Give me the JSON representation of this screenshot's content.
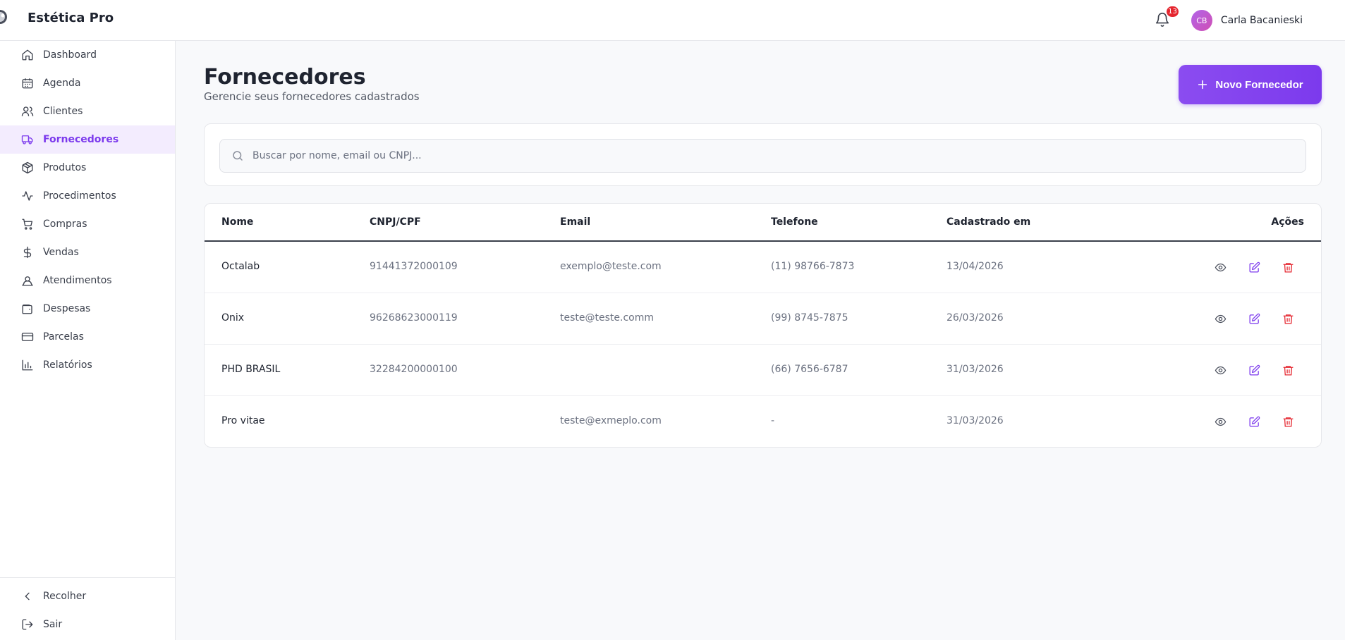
{
  "app": {
    "name": "Estética Pro"
  },
  "header": {
    "notifications_count": "13",
    "user_initials": "CB",
    "user_name": "Carla Bacanieski"
  },
  "sidebar": {
    "items": [
      {
        "label": "Dashboard",
        "icon": "home-icon"
      },
      {
        "label": "Agenda",
        "icon": "calendar-icon"
      },
      {
        "label": "Clientes",
        "icon": "users-icon"
      },
      {
        "label": "Fornecedores",
        "icon": "truck-icon",
        "active": true
      },
      {
        "label": "Produtos",
        "icon": "package-icon"
      },
      {
        "label": "Procedimentos",
        "icon": "activity-icon"
      },
      {
        "label": "Compras",
        "icon": "cart-icon"
      },
      {
        "label": "Vendas",
        "icon": "dollar-icon"
      },
      {
        "label": "Atendimentos",
        "icon": "user-pin-icon"
      },
      {
        "label": "Despesas",
        "icon": "wallet-icon"
      },
      {
        "label": "Parcelas",
        "icon": "credit-card-icon"
      },
      {
        "label": "Relatórios",
        "icon": "bar-chart-icon"
      }
    ],
    "collapse_label": "Recolher",
    "logout_label": "Sair"
  },
  "page": {
    "title": "Fornecedores",
    "subtitle": "Gerencie seus fornecedores cadastrados",
    "new_button_label": "Novo Fornecedor"
  },
  "search": {
    "placeholder": "Buscar por nome, email ou CNPJ...",
    "value": ""
  },
  "table": {
    "columns": [
      "Nome",
      "CNPJ/CPF",
      "Email",
      "Telefone",
      "Cadastrado em",
      "Ações"
    ],
    "rows": [
      {
        "nome": "Octalab",
        "cnpj": "91441372000109",
        "email": "exemplo@teste.com",
        "telefone": "(11) 98766-7873",
        "cadastrado": "13/04/2026"
      },
      {
        "nome": "Onix",
        "cnpj": "96268623000119",
        "email": "teste@teste.comm",
        "telefone": "(99) 8745-7875",
        "cadastrado": "26/03/2026"
      },
      {
        "nome": "PHD BRASIL",
        "cnpj": "32284200000100",
        "email": "",
        "telefone": "(66) 7656-6787",
        "cadastrado": "31/03/2026"
      },
      {
        "nome": "Pro vitae",
        "cnpj": "",
        "email": "teste@exmeplo.com",
        "telefone": "-",
        "cadastrado": "31/03/2026"
      }
    ]
  },
  "colors": {
    "accent": "#7c3aed",
    "danger": "#e5262f"
  }
}
